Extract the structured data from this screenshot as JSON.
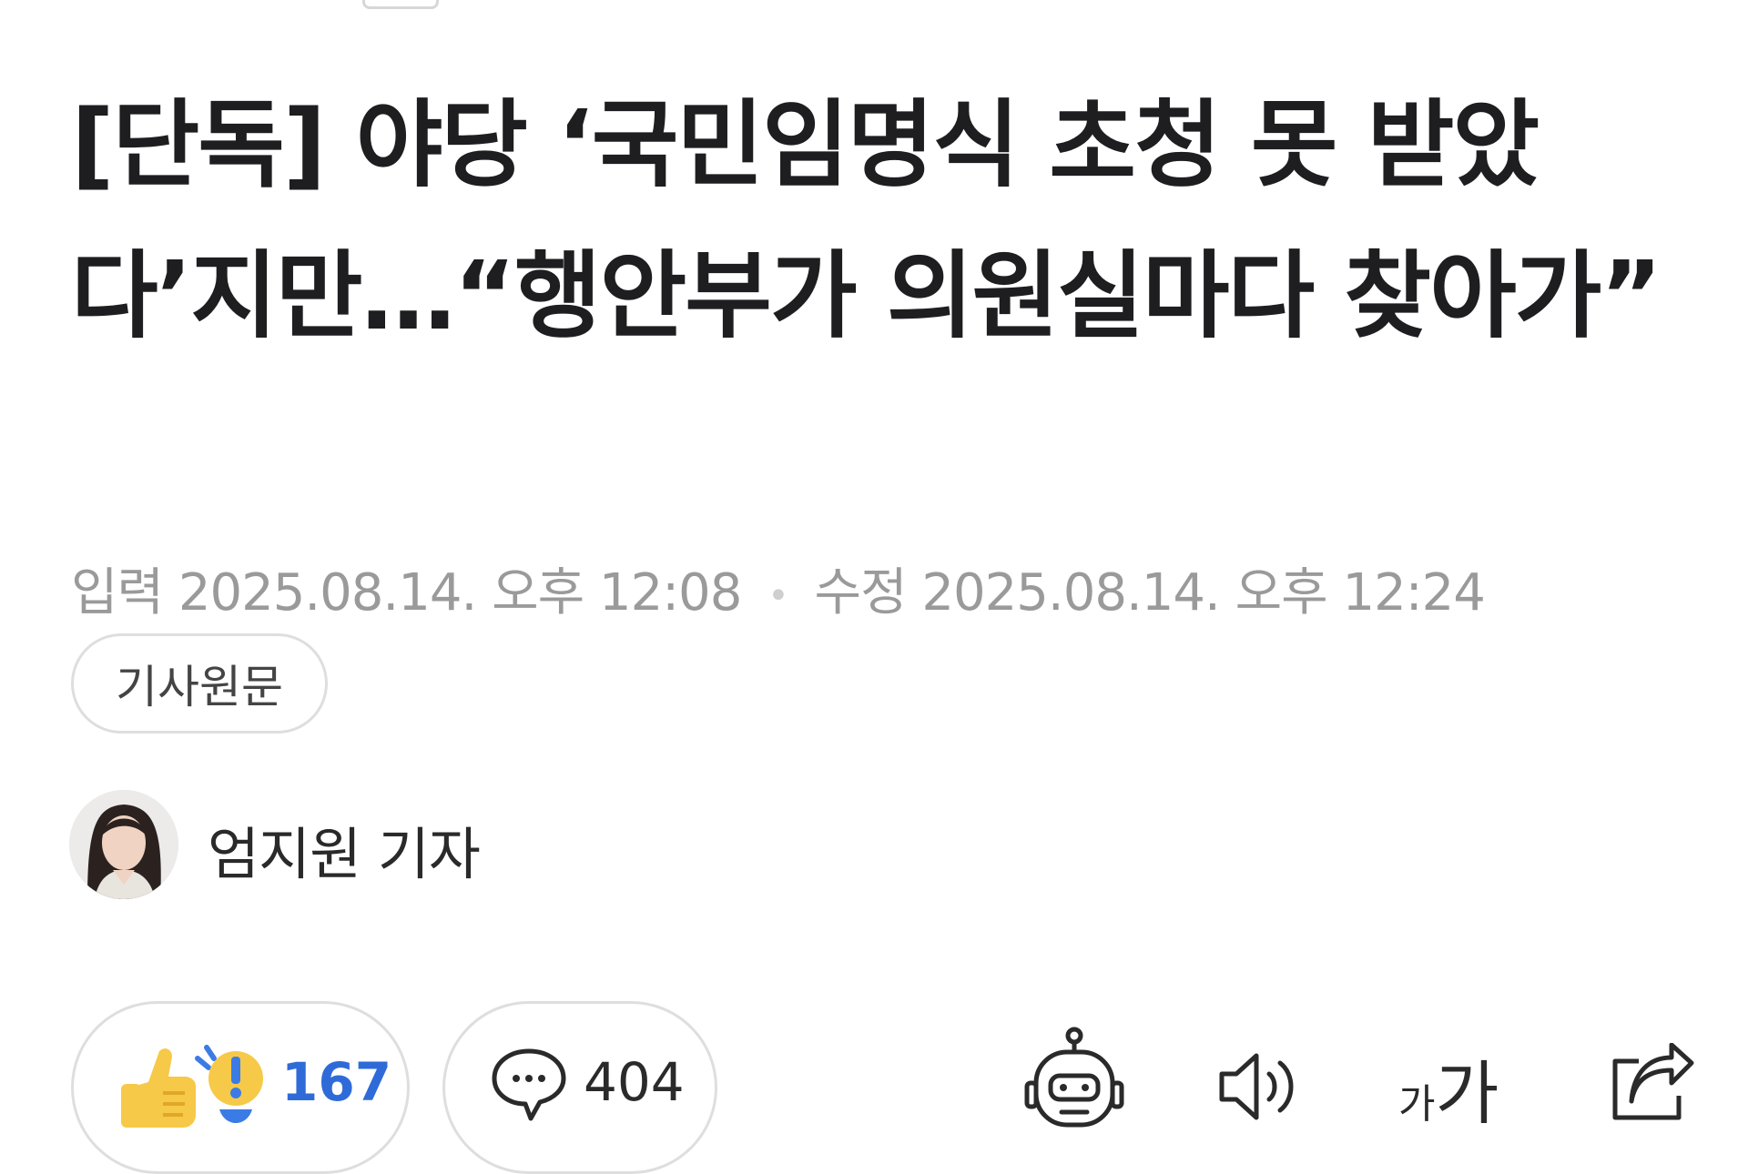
{
  "article": {
    "headline": "[단독] 야당 ‘국민임명식 초청 못 받았다’지만…“행안부가 의원실마다 찾아가”",
    "input_label": "입력",
    "input_datetime": "2025.08.14. 오후 12:08",
    "modified_label": "수정",
    "modified_datetime": "2025.08.14. 오후 12:24",
    "original_button": "기사원문",
    "author": "엄지원 기자"
  },
  "actions": {
    "reaction_count": "167",
    "comment_count": "404",
    "font_size_small": "가",
    "font_size_big": "가"
  },
  "icons": [
    "thumbs-up-surprise-icon",
    "comment-icon",
    "robot-summary-icon",
    "speaker-icon",
    "font-size-icon",
    "share-icon"
  ],
  "colors": {
    "reaction_count": "#2f6bd8",
    "meta_text": "#9a9a9a",
    "emoji_yellow": "#f7c948",
    "emoji_blue": "#3b7be6"
  }
}
